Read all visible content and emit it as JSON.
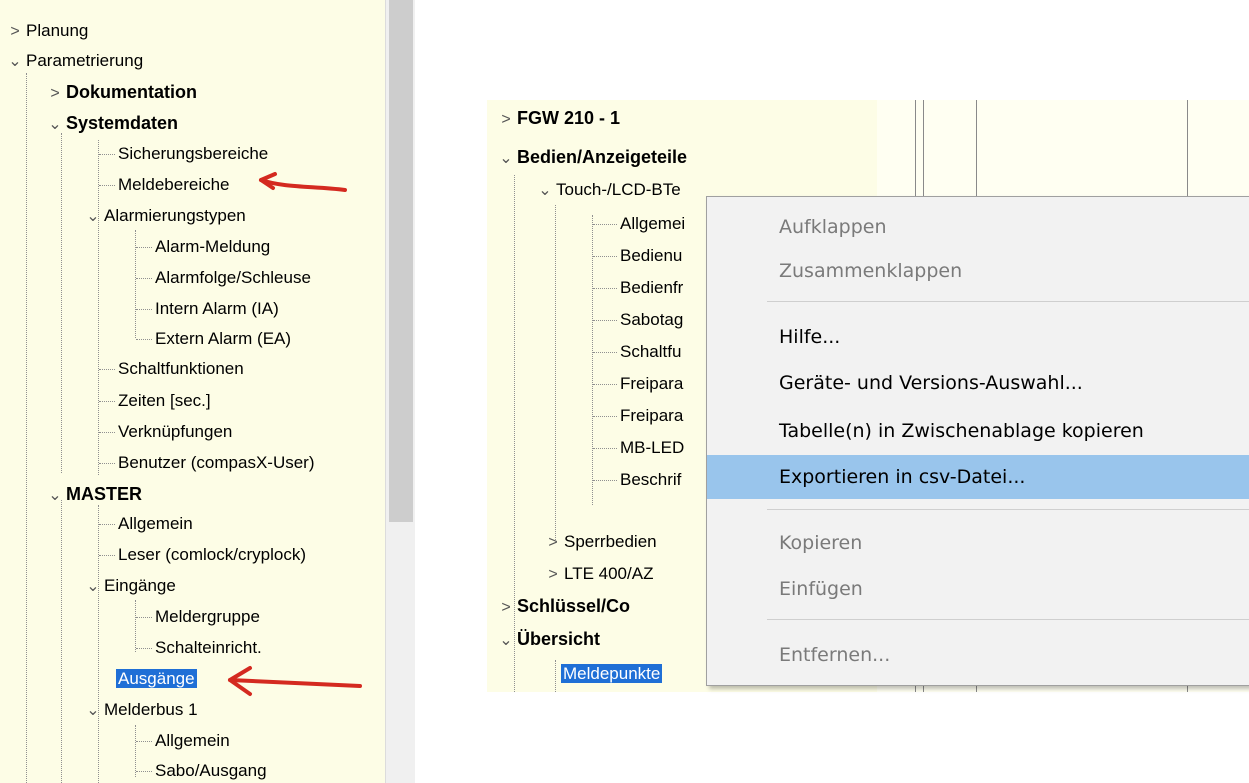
{
  "left_tree": {
    "items": [
      {
        "label": "Planung",
        "chevron": "collapsed"
      },
      {
        "label": "Parametrierung",
        "chevron": "expanded"
      },
      {
        "label": "Dokumentation",
        "chevron": "collapsed"
      },
      {
        "label": "Systemdaten",
        "chevron": "expanded"
      },
      {
        "label": "Sicherungsbereiche"
      },
      {
        "label": "Meldebereiche"
      },
      {
        "label": "Alarmierungstypen",
        "chevron": "expanded"
      },
      {
        "label": "Alarm-Meldung"
      },
      {
        "label": "Alarmfolge/Schleuse"
      },
      {
        "label": "Intern Alarm (IA)"
      },
      {
        "label": "Extern Alarm (EA)"
      },
      {
        "label": "Schaltfunktionen"
      },
      {
        "label": "Zeiten [sec.]"
      },
      {
        "label": "Verknüpfungen"
      },
      {
        "label": "Benutzer (compasX-User)"
      },
      {
        "label": "MASTER",
        "chevron": "expanded"
      },
      {
        "label": "Allgemein"
      },
      {
        "label": "Leser (comlock/cryplock)"
      },
      {
        "label": "Eingänge",
        "chevron": "expanded"
      },
      {
        "label": "Meldergruppe"
      },
      {
        "label": "Schalteinricht."
      },
      {
        "label": "Ausgänge",
        "selected": true
      },
      {
        "label": "Melderbus 1",
        "chevron": "expanded"
      },
      {
        "label": "Allgemein"
      },
      {
        "label": "Sabo/Ausgang"
      }
    ]
  },
  "right_tree": {
    "items": [
      {
        "label": "FGW 210 - 1",
        "chevron": "collapsed"
      },
      {
        "label": "Bedien/Anzeigeteile",
        "chevron": "expanded"
      },
      {
        "label": "Touch-/LCD-BTe",
        "chevron": "expanded"
      },
      {
        "label": "Allgemei"
      },
      {
        "label": "Bedienu"
      },
      {
        "label": "Bedienfr"
      },
      {
        "label": "Sabotag"
      },
      {
        "label": "Schaltfu"
      },
      {
        "label": "Freipara"
      },
      {
        "label": "Freipara"
      },
      {
        "label": "MB-LED"
      },
      {
        "label": "Beschrif"
      },
      {
        "label": "Sperrbedien",
        "chevron": "collapsed"
      },
      {
        "label": "LTE 400/AZ",
        "chevron": "collapsed"
      },
      {
        "label": "Schlüssel/Co",
        "chevron": "collapsed"
      },
      {
        "label": "Übersicht",
        "chevron": "expanded"
      },
      {
        "label": "Meldepunkte",
        "selected": true
      }
    ]
  },
  "context_menu": {
    "items": [
      {
        "label": "Aufklappen",
        "enabled": false
      },
      {
        "label": "Zusammenklappen",
        "enabled": false
      },
      {
        "label": "Hilfe...",
        "enabled": true
      },
      {
        "label": "Geräte- und Versions-Auswahl...",
        "enabled": true
      },
      {
        "label": "Tabelle(n) in Zwischenablage kopieren",
        "enabled": true
      },
      {
        "label": "Exportieren in csv-Datei...",
        "enabled": true,
        "highlighted": true
      },
      {
        "label": "Kopieren",
        "enabled": false
      },
      {
        "label": "Einfügen",
        "enabled": false
      },
      {
        "label": "Entfernen...",
        "enabled": false
      }
    ]
  },
  "annotations": {
    "arrow_color": "#d42a20"
  },
  "colors": {
    "tree_background": "#fdfde6",
    "selection": "#1f6fd6",
    "menu_highlight": "#99c5ec"
  }
}
